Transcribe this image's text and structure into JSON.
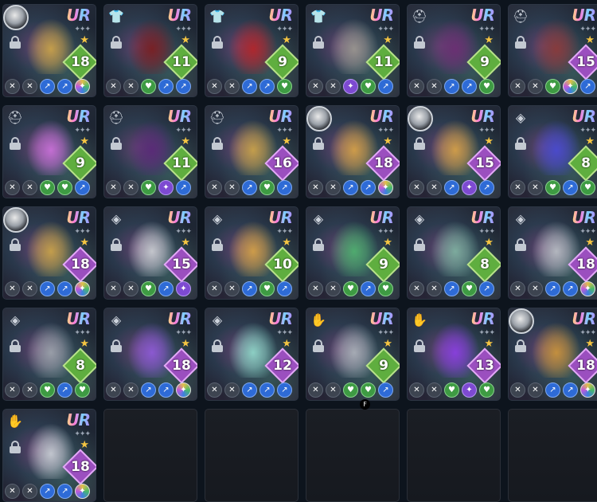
{
  "hotkey_hint": "F",
  "items": [
    {
      "slot": "portrait",
      "level": "18",
      "level_color": "green",
      "subs": [
        "grey",
        "grey",
        "blue",
        "blue",
        "multi"
      ],
      "art": "#c9a24a"
    },
    {
      "slot": "body",
      "level": "11",
      "level_color": "green",
      "subs": [
        "grey",
        "grey",
        "green",
        "blue",
        "blue"
      ],
      "art": "#7a1f22"
    },
    {
      "slot": "body",
      "level": "9",
      "level_color": "green",
      "subs": [
        "grey",
        "grey",
        "blue",
        "blue",
        "green"
      ],
      "art": "#b3262b"
    },
    {
      "slot": "body",
      "level": "11",
      "level_color": "green",
      "subs": [
        "grey",
        "grey",
        "purple",
        "green",
        "blue"
      ],
      "art": "#9a9690"
    },
    {
      "slot": "head",
      "level": "9",
      "level_color": "green",
      "subs": [
        "grey",
        "grey",
        "blue",
        "blue",
        "green"
      ],
      "art": "#6b2f73"
    },
    {
      "slot": "head",
      "level": "15",
      "level_color": "purple",
      "subs": [
        "grey",
        "grey",
        "green",
        "multi",
        "blue"
      ],
      "art": "#8a3b3b"
    },
    {
      "slot": "head",
      "level": "9",
      "level_color": "green",
      "subs": [
        "grey",
        "grey",
        "green",
        "green",
        "blue"
      ],
      "art": "#c970d8"
    },
    {
      "slot": "head",
      "level": "11",
      "level_color": "green",
      "subs": [
        "grey",
        "grey",
        "green",
        "purple",
        "blue"
      ],
      "art": "#5a2a78"
    },
    {
      "slot": "head",
      "level": "16",
      "level_color": "purple",
      "subs": [
        "grey",
        "grey",
        "blue",
        "green",
        "blue"
      ],
      "art": "#c9a24a"
    },
    {
      "slot": "portrait",
      "level": "18",
      "level_color": "purple",
      "subs": [
        "grey",
        "grey",
        "blue",
        "blue",
        "multi"
      ],
      "art": "#d4a048"
    },
    {
      "slot": "portrait",
      "level": "15",
      "level_color": "purple",
      "subs": [
        "grey",
        "grey",
        "blue",
        "purple",
        "blue"
      ],
      "art": "#d4a048"
    },
    {
      "slot": "gem",
      "level": "8",
      "level_color": "green",
      "subs": [
        "grey",
        "grey",
        "green",
        "blue",
        "green"
      ],
      "art": "#4a4ad0"
    },
    {
      "slot": "portrait",
      "level": "18",
      "level_color": "purple",
      "subs": [
        "grey",
        "grey",
        "blue",
        "blue",
        "multi"
      ],
      "art": "#c9a24a"
    },
    {
      "slot": "gem",
      "level": "15",
      "level_color": "purple",
      "subs": [
        "grey",
        "grey",
        "green",
        "blue",
        "purple"
      ],
      "art": "#c9ccd1"
    },
    {
      "slot": "gem",
      "level": "10",
      "level_color": "green",
      "subs": [
        "grey",
        "grey",
        "blue",
        "green",
        "blue"
      ],
      "art": "#d4a048"
    },
    {
      "slot": "gem",
      "level": "9",
      "level_color": "green",
      "subs": [
        "grey",
        "grey",
        "green",
        "blue",
        "green"
      ],
      "art": "#4fb06f"
    },
    {
      "slot": "gem",
      "level": "8",
      "level_color": "green",
      "subs": [
        "grey",
        "grey",
        "blue",
        "green",
        "blue"
      ],
      "art": "#7fb0a0"
    },
    {
      "slot": "gem",
      "level": "18",
      "level_color": "purple",
      "subs": [
        "grey",
        "grey",
        "blue",
        "blue",
        "multi"
      ],
      "art": "#b8bcc3"
    },
    {
      "slot": "gem",
      "level": "8",
      "level_color": "green",
      "subs": [
        "grey",
        "grey",
        "green",
        "blue",
        "green"
      ],
      "art": "#9ca2ab"
    },
    {
      "slot": "gem",
      "level": "18",
      "level_color": "purple",
      "subs": [
        "grey",
        "grey",
        "blue",
        "blue",
        "multi"
      ],
      "art": "#8e5ad6"
    },
    {
      "slot": "gem",
      "level": "12",
      "level_color": "purple",
      "subs": [
        "grey",
        "grey",
        "blue",
        "blue",
        "blue"
      ],
      "art": "#8fd6c8"
    },
    {
      "slot": "hand",
      "level": "9",
      "level_color": "green",
      "subs": [
        "grey",
        "grey",
        "green",
        "green",
        "blue"
      ],
      "art": "#aab0b8"
    },
    {
      "slot": "hand",
      "level": "13",
      "level_color": "purple",
      "subs": [
        "grey",
        "grey",
        "green",
        "purple",
        "green"
      ],
      "art": "#8a3fe0"
    },
    {
      "slot": "portrait",
      "level": "18",
      "level_color": "purple",
      "subs": [
        "grey",
        "grey",
        "blue",
        "blue",
        "multi"
      ],
      "art": "#c9933c"
    },
    {
      "slot": "hand",
      "level": "18",
      "level_color": "purple",
      "subs": [
        "grey",
        "grey",
        "blue",
        "blue",
        "multi"
      ],
      "art": "#c7ccd3"
    }
  ],
  "empty_slots": 5,
  "labels": {
    "rarity": "UR",
    "locked": "locked"
  }
}
